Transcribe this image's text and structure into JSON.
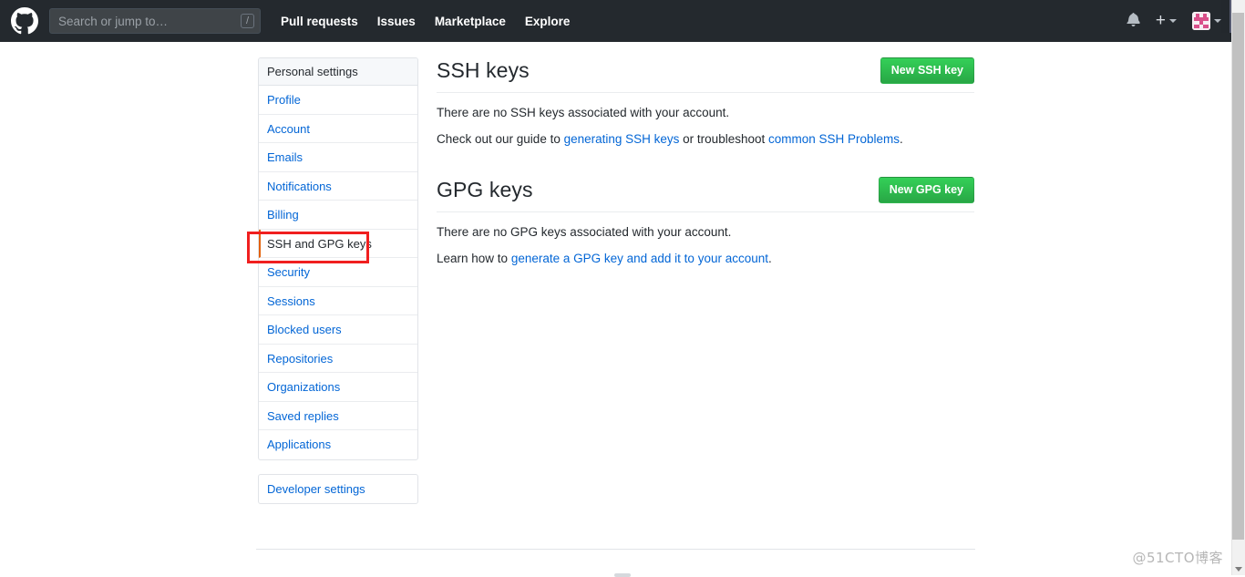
{
  "header": {
    "logo_icon": "github-mark-icon",
    "search": {
      "placeholder": "Search or jump to…",
      "value": "",
      "shortcut_hint": "/"
    },
    "nav": [
      {
        "label": "Pull requests"
      },
      {
        "label": "Issues"
      },
      {
        "label": "Marketplace"
      },
      {
        "label": "Explore"
      }
    ],
    "right": {
      "notifications_icon": "bell-icon",
      "create_new_icon": "plus-icon",
      "create_new_caret_icon": "chevron-down-icon",
      "avatar_icon": "user-avatar-identicon",
      "avatar_caret_icon": "chevron-down-icon"
    },
    "background_color": "#24292e"
  },
  "sidebar": {
    "heading": "Personal settings",
    "items": [
      {
        "label": "Profile",
        "selected": false
      },
      {
        "label": "Account",
        "selected": false
      },
      {
        "label": "Emails",
        "selected": false
      },
      {
        "label": "Notifications",
        "selected": false
      },
      {
        "label": "Billing",
        "selected": false
      },
      {
        "label": "SSH and GPG keys",
        "selected": true
      },
      {
        "label": "Security",
        "selected": false
      },
      {
        "label": "Sessions",
        "selected": false
      },
      {
        "label": "Blocked users",
        "selected": false
      },
      {
        "label": "Repositories",
        "selected": false
      },
      {
        "label": "Organizations",
        "selected": false
      },
      {
        "label": "Saved replies",
        "selected": false
      },
      {
        "label": "Applications",
        "selected": false
      }
    ],
    "developer_settings": {
      "label": "Developer settings"
    },
    "selected_accent_color": "#e36209",
    "link_color": "#0366d6"
  },
  "main": {
    "ssh": {
      "title": "SSH keys",
      "button_label": "New SSH key",
      "empty_text": "There are no SSH keys associated with your account.",
      "guide_prefix": "Check out our guide to ",
      "guide_link_1": "generating SSH keys",
      "guide_middle": " or troubleshoot ",
      "guide_link_2": "common SSH Problems",
      "guide_suffix": "."
    },
    "gpg": {
      "title": "GPG keys",
      "button_label": "New GPG key",
      "empty_text": "There are no GPG keys associated with your account.",
      "guide_prefix": "Learn how to ",
      "guide_link_1": "generate a GPG key and add it to your account",
      "guide_suffix": "."
    },
    "button_color": "#2cbe4e"
  },
  "annotations": {
    "color": "#f01f1f",
    "sidebar_box_target": "SSH and GPG keys",
    "button_box_target": "New SSH key"
  },
  "watermark": {
    "text": "@51CTO博客"
  },
  "scrollbar": {
    "orientation": "vertical",
    "position": "right"
  }
}
